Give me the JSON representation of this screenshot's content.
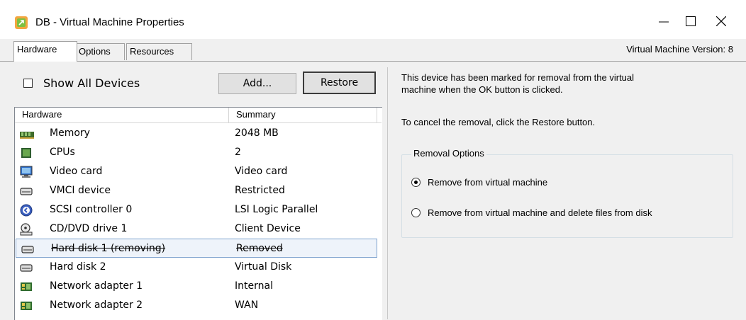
{
  "window": {
    "title": "DB - Virtual Machine Properties",
    "app_icon": "vm-properties-icon",
    "controls": [
      "minimize-icon",
      "maximize-icon",
      "close-icon"
    ]
  },
  "tabs": [
    {
      "label": "Hardware",
      "active": true
    },
    {
      "label": "Options",
      "active": false
    },
    {
      "label": "Resources",
      "active": false
    }
  ],
  "vm_version": "Virtual Machine Version: 8",
  "show_all_devices": {
    "label": "Show All Devices",
    "checked": false
  },
  "buttons": {
    "add": "Add...",
    "restore": "Restore"
  },
  "hardware_table": {
    "columns": [
      "Hardware",
      "Summary"
    ],
    "rows": [
      {
        "icon": "memory-icon",
        "name": "Memory",
        "summary": "2048 MB"
      },
      {
        "icon": "cpu-icon",
        "name": "CPUs",
        "summary": "2"
      },
      {
        "icon": "monitor-icon",
        "name": "Video card",
        "summary": "Video card"
      },
      {
        "icon": "device-icon",
        "name": "VMCI device",
        "summary": "Restricted"
      },
      {
        "icon": "scsi-icon",
        "name": "SCSI controller 0",
        "summary": "LSI Logic Parallel"
      },
      {
        "icon": "cd-dvd-icon",
        "name": "CD/DVD drive 1",
        "summary": "Client Device"
      },
      {
        "icon": "hard-disk-icon",
        "name": "Hard disk 1 (removing)",
        "summary": "Removed",
        "selected": true,
        "removed": true
      },
      {
        "icon": "hard-disk-icon",
        "name": "Hard disk 2",
        "summary": "Virtual Disk"
      },
      {
        "icon": "network-adapter-icon",
        "name": "Network adapter 1",
        "summary": "Internal"
      },
      {
        "icon": "network-adapter-icon",
        "name": "Network adapter 2",
        "summary": "WAN"
      }
    ]
  },
  "details": {
    "removal_notice_line1": "This device has been marked for removal from the virtual",
    "removal_notice_line2": "machine when the OK button is clicked.",
    "cancel_notice": "To cancel the removal, click the Restore button.",
    "removal_options": {
      "title": "Removal Options",
      "options": [
        {
          "label": "Remove from virtual machine",
          "selected": true
        },
        {
          "label": "Remove from virtual machine and delete files from disk",
          "selected": false
        }
      ]
    }
  },
  "colors": {
    "selection_border": "#7da2ce",
    "selection_fill": "#eef3fa",
    "window_bg": "#f0f0f0"
  }
}
